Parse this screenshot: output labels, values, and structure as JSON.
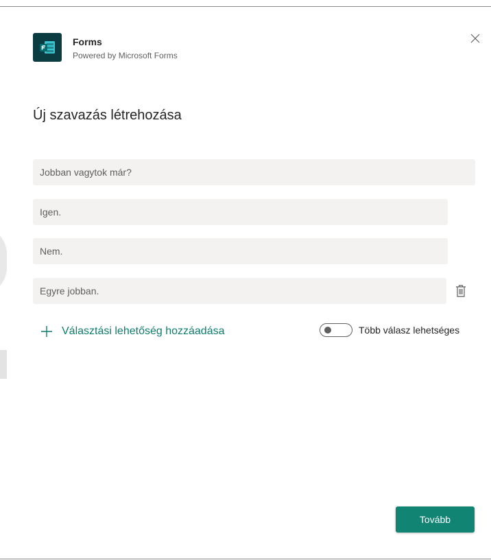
{
  "app": {
    "name": "Forms",
    "subtitle": "Powered by Microsoft Forms",
    "logo_icon": "forms-logo-icon",
    "logo_color": "#0b3c42"
  },
  "dialog": {
    "title": "Új szavazás létrehozása",
    "close_icon": "close-icon"
  },
  "poll": {
    "question": "Jobban vagytok már?",
    "options": [
      "Igen.",
      "Nem.",
      "Egyre jobban."
    ],
    "delete_icon": "trash-icon",
    "add_option_label": "Választási lehetőség hozzáadása",
    "multiple_answers_label": "Több válasz lehetséges",
    "multiple_answers_enabled": false
  },
  "footer": {
    "next_label": "Tovább"
  },
  "colors": {
    "accent": "#0f7c6e",
    "button": "#118473",
    "field_bg": "#f3f2f1"
  }
}
